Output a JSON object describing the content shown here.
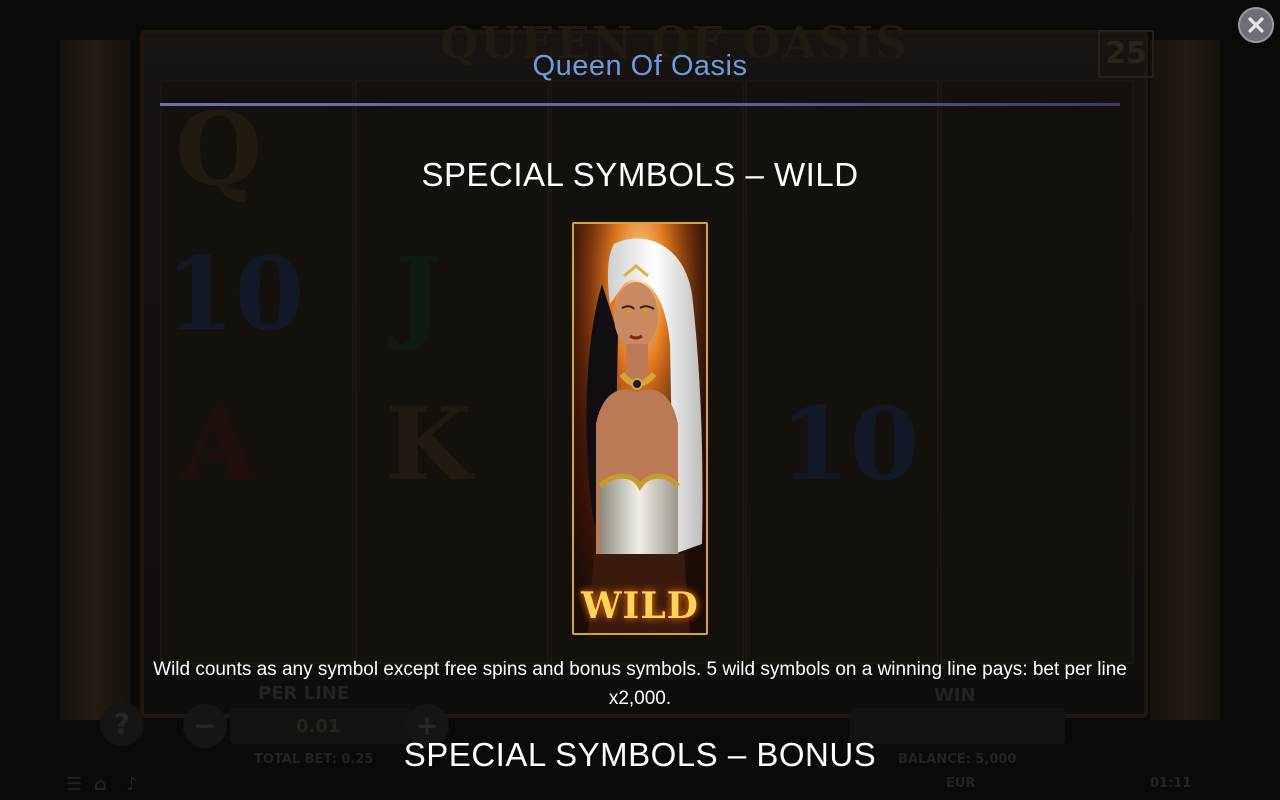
{
  "background": {
    "logo": "QUEEN OF OASIS",
    "paylines": "25",
    "per_line_label": "PER LINE",
    "per_line_value": "0.01",
    "total_bet": "TOTAL BET: 0.25",
    "win_label": "WIN",
    "balance": "BALANCE: 5,000",
    "currency": "EUR",
    "clock": "01:11",
    "symbols": [
      "Q",
      "10",
      "J",
      "A",
      "K",
      "10"
    ]
  },
  "overlay": {
    "title": "Queen Of Oasis",
    "close_icon": "close-icon",
    "sections": [
      {
        "heading": "SPECIAL SYMBOLS – WILD",
        "symbol_label": "WILD",
        "description": "Wild counts as any symbol except free spins and bonus symbols. 5 wild symbols on a winning line pays: bet per line x2,000."
      },
      {
        "heading": "SPECIAL SYMBOLS – BONUS"
      }
    ]
  },
  "colors": {
    "title": "#6c9bdf",
    "rule": "#6f6fb3",
    "card_border": "#d5a53c",
    "wild_text": "#ffd35a"
  }
}
